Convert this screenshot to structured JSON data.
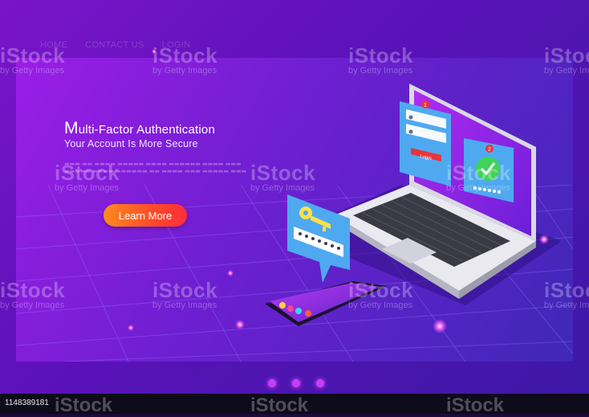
{
  "nav": {
    "items": [
      "HOME",
      "CONTACT US",
      "LOGIN"
    ]
  },
  "hero": {
    "title_first_letter": "M",
    "title_rest": "ulti-Factor Authentication",
    "subtitle": "Your Account Is More Secure",
    "cta_label": "Learn More"
  },
  "login_form": {
    "button_label": "Login",
    "badge_1": "1",
    "badge_2": "2"
  },
  "watermark": {
    "brand": "iStock",
    "credit": "by Getty Images"
  },
  "image_id": "1148389181",
  "colors": {
    "accent_orange": "#ff8a1c",
    "accent_red": "#ff2d3c",
    "panel_blue": "#4fa9f0",
    "key_yellow": "#ffe04a",
    "check_green": "#3fd35a"
  }
}
